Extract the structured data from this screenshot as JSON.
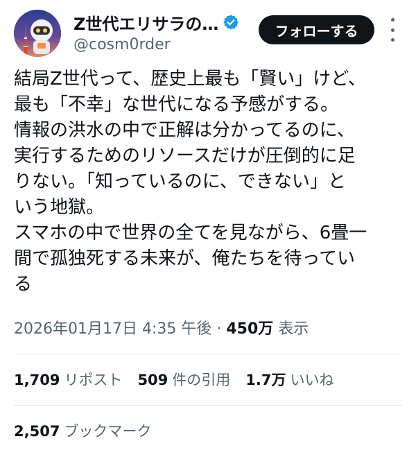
{
  "header": {
    "display_name": "Z世代エリサラの…",
    "handle": "@cosm0rder",
    "follow_label": "フォローする",
    "verified_color": "#1d9bf0"
  },
  "tweet": {
    "text": "結局Z世代って、歴史上最も「賢い」けど、\n最も「不幸」な世代になる予感がする。\n情報の洪水の中で正解は分かってるのに、\n実行するためのリソースだけが圧倒的に足\nりない。「知っているのに、できない」と\nいう地獄。\nスマホの中で世界の全てを見ながら、6畳一\n間で孤独死する未来が、俺たちを待ってい\nる"
  },
  "meta": {
    "timestamp": "2026年01月17日 4:35 午後",
    "separator": " · ",
    "views_count": "450万",
    "views_label": " 表示"
  },
  "stats": {
    "reposts_value": "1,709",
    "reposts_label": "リポスト",
    "quotes_value": "509",
    "quotes_label": "件の引用",
    "likes_value": "1.7万",
    "likes_label": "いいね",
    "bookmarks_value": "2,507",
    "bookmarks_label": "ブックマーク"
  },
  "icons": {
    "verified": "verified-badge-icon",
    "more": "more-options-icon",
    "avatar": "avatar-image"
  }
}
